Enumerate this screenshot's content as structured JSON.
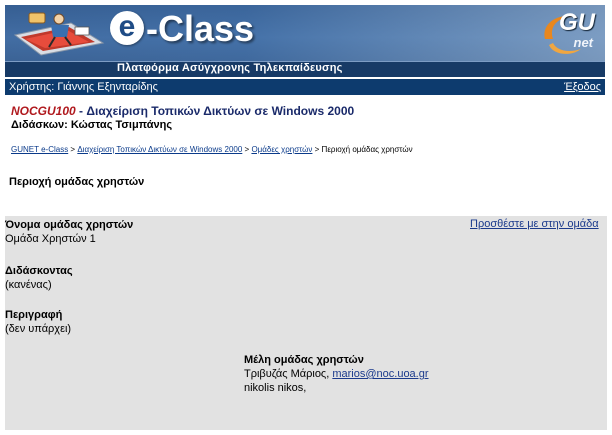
{
  "header": {
    "logo_e": "e",
    "logo_text": "-Class",
    "tagline": "Πλατφόρμα Ασύγχρονης Τηλεκπαίδευσης",
    "partner_logo_main": "GU",
    "partner_logo_sub": "net"
  },
  "userbar": {
    "user_label": "Χρήστης: Γιάννης Εξηνταρίδης",
    "logout_label": "Έξοδος"
  },
  "course": {
    "code": "NOCGU100",
    "separator": " - ",
    "title": "Διαχείριση Τοπικών Δικτύων σε Windows 2000",
    "teacher": "Διδάσκων: Κώστας Τσιμπάνης"
  },
  "breadcrumb": {
    "items": [
      "GUNET e-Class",
      "Διαχείριση Τοπικών Δικτύων σε Windows 2000",
      "Ομάδες χρηστών"
    ],
    "separator": " > ",
    "current": "Περιοχή ομάδας χρηστών"
  },
  "page": {
    "title": "Περιοχή ομάδας χρηστών"
  },
  "group": {
    "add_me_label": "Προσθέστε με στην ομάδα",
    "name_label": "Όνομα ομάδας χρηστών",
    "name_value": "Ομάδα Χρηστών 1",
    "tutor_label": "Διδάσκοντας",
    "tutor_value": "(κανένας)",
    "description_label": "Περιγραφή",
    "description_value": "(δεν υπάρχει)",
    "members_label": "Μέλη ομάδας χρηστών",
    "members": [
      {
        "name": "Τριβυζάς Μάριος, ",
        "email": "marios@noc.uoa.gr"
      },
      {
        "name": "nikolis nikos,",
        "email": ""
      }
    ]
  },
  "colors": {
    "banner": "#1f4c86",
    "userbar": "#0d3b6e",
    "course_code": "#b0191e",
    "link": "#1b3a8c",
    "panel": "#e2e2e2"
  }
}
